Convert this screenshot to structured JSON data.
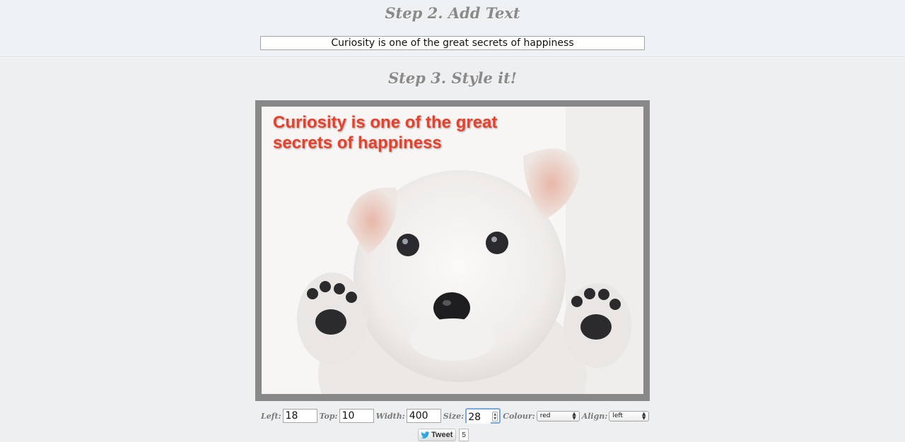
{
  "step2": {
    "title": "Step 2. Add Text",
    "text_value": "Curiosity is one of the great secrets of happiness"
  },
  "step3": {
    "title": "Step 3. Style it!",
    "overlay_text": "Curiosity is one of the great secrets of happiness",
    "overlay_color": "#e8402a",
    "image_subject": "white-puppy-image"
  },
  "controls": {
    "left_label": "Left:",
    "left_value": "18",
    "top_label": "Top:",
    "top_value": "10",
    "width_label": "Width:",
    "width_value": "400",
    "size_label": "Size:",
    "size_value": "28",
    "colour_label": "Colour:",
    "colour_value": "red",
    "align_label": "Align:",
    "align_value": "left"
  },
  "share": {
    "tweet_label": "Tweet",
    "tweet_count": "5",
    "tweet_icon": "twitter-bird-icon"
  }
}
